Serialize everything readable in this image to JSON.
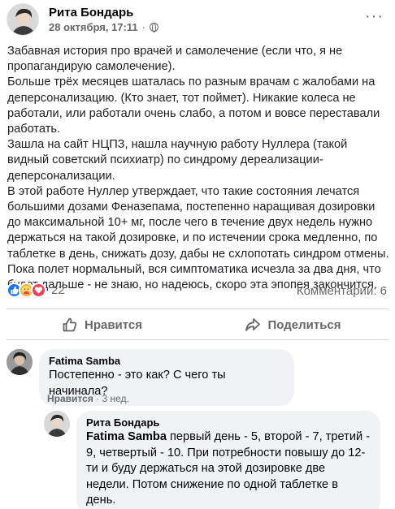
{
  "post": {
    "author": "Рита Бондарь",
    "timestamp": "28 октября, 17:11",
    "separator": "·",
    "more_label": "···",
    "paragraphs": [
      "Забавная история про врачей и самолечение (если что, я не пропагандирую самолечение).",
      "Больше трёх месяцев шаталась по разным врачам с жалобами на деперсонализацию. (Кто знает, тот поймет). Никакие колеса не работали, или работали очень слабо, а потом и вовсе переставали работать.",
      "Зашла на сайт НЦПЗ, нашла научную работу Нуллера (такой видный советский психиатр) по синдрому дереализации-деперсонализации.",
      "В этой работе Нуллер утверждает, что такие состояния лечатся большими дозами Феназепама, постепенно наращивая дозировки до максимальной 10+ мг, после чего в течение двух недель нужно держаться на такой дозировке, и по истечении срока медленно, по таблетке в день, снижать дозу, дабы не схлопотать синдром отмены.",
      "Пока полет нормальный, вся симптоматика исчезла за два дня, что будет дальше - не знаю, но надеюсь, скоро эта эпопея закончится."
    ],
    "reaction_count": "22",
    "comments_count": "Комментарии: 6"
  },
  "actions": {
    "like_label": "Нравится",
    "share_label": "Поделиться"
  },
  "comments": [
    {
      "author": "Fatima Samba",
      "text": "Постепенно - это как? С чего ты начинала?",
      "like_label": "Нравится",
      "time": "3 нед."
    }
  ],
  "reply": {
    "author": "Рита Бондарь",
    "mention": "Fatima Samba",
    "text": " первый день - 5, второй - 7, третий - 9, четвертый - 10. При потребности повышу до 12-ти и буду держаться на этой дозировке две недели. Потом снижение по одной таблетке в день."
  },
  "colors": {
    "brand_blue": "#1877f2",
    "secondary_text": "#65676b",
    "bubble_bg": "#f0f2f5"
  }
}
